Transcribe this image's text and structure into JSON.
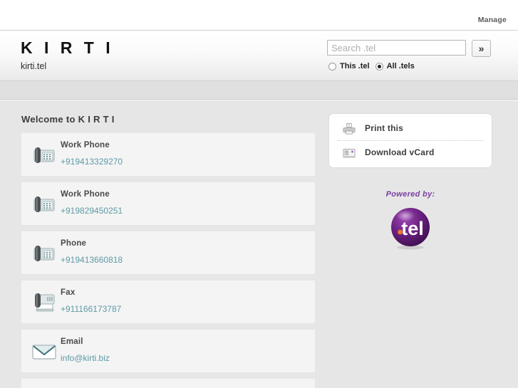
{
  "topbar": {
    "manage_label": "Manage"
  },
  "header": {
    "site_title": "K I R T I",
    "site_domain": "kirti.tel",
    "search": {
      "placeholder": "Search .tel",
      "value": "",
      "go_label": "»",
      "scopes": [
        {
          "label": "This .tel",
          "selected": false
        },
        {
          "label": "All .tels",
          "selected": true
        }
      ]
    }
  },
  "main": {
    "welcome_heading": "Welcome to K I R T I",
    "contacts": [
      {
        "label": "Work Phone",
        "value": "+919413329270",
        "icon": "desk-phone-icon"
      },
      {
        "label": "Work Phone",
        "value": "+919829450251",
        "icon": "desk-phone-icon"
      },
      {
        "label": "Phone",
        "value": "+919413660818",
        "icon": "desk-phone-icon"
      },
      {
        "label": "Fax",
        "value": "+911166173787",
        "icon": "fax-icon"
      },
      {
        "label": "Email",
        "value": "info@kirti.biz",
        "icon": "envelope-icon"
      }
    ]
  },
  "sidebar": {
    "actions": [
      {
        "label": "Print this",
        "icon": "printer-icon"
      },
      {
        "label": "Download vCard",
        "icon": "vcard-icon"
      }
    ],
    "powered_by": {
      "text": "Powered by:",
      "logo_text": ".tel"
    }
  },
  "colors": {
    "link": "#5d9aa6",
    "page_background": "#e6e6e6",
    "card_background": "#f4f4f4",
    "powered_by_text": "#7a3fa0",
    "tel_logo_purple": "#6b2080",
    "tel_logo_dot": "#f07820"
  }
}
